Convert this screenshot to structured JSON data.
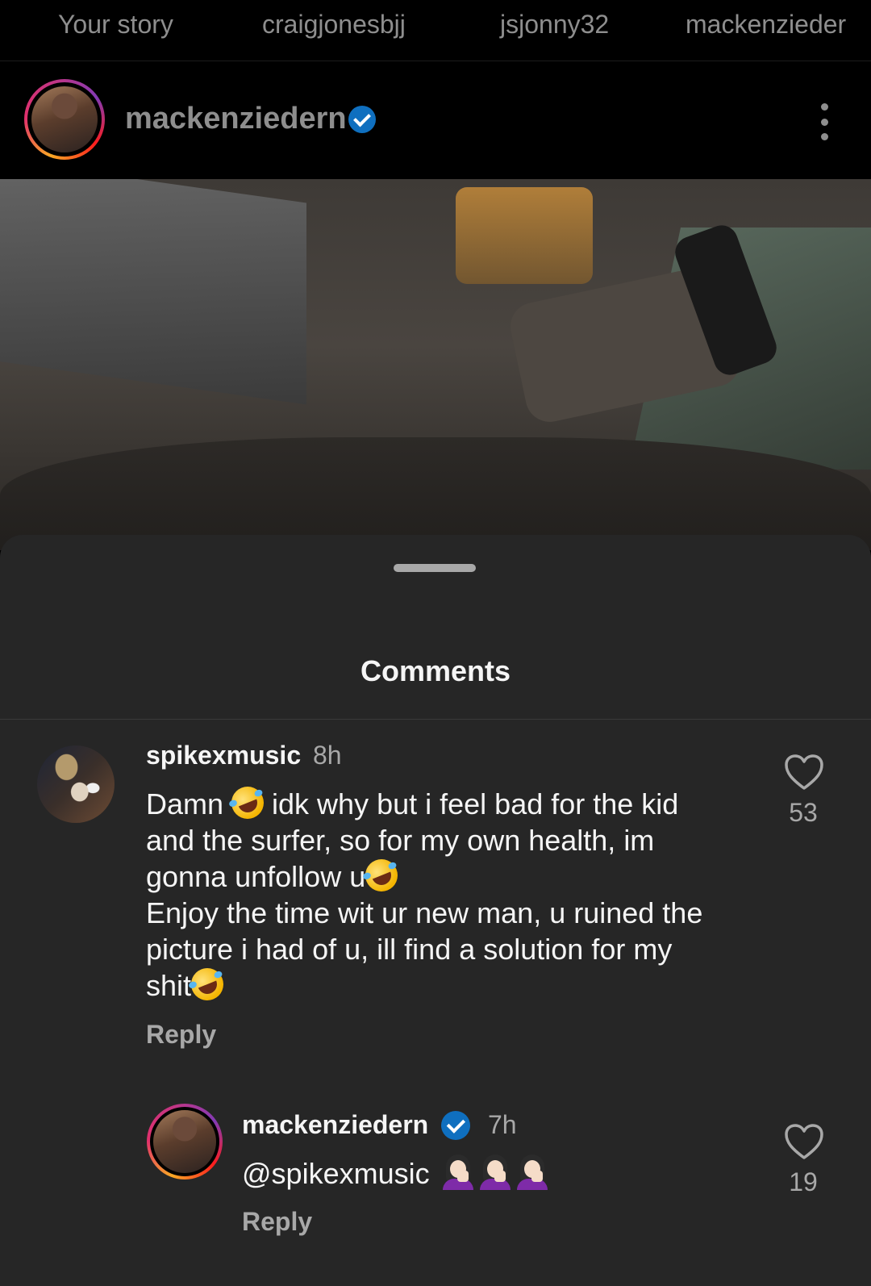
{
  "stories": {
    "tabs": [
      "Your story",
      "craigjonesbjj",
      "jsjonny32",
      "mackenzieder"
    ]
  },
  "post": {
    "username": "mackenziedern",
    "verified": true,
    "menu_icon": "more-vertical-icon"
  },
  "comments_sheet": {
    "title": "Comments",
    "comments": [
      {
        "username": "spikexmusic",
        "time": "8h",
        "text_parts": {
          "p1": "Damn ",
          "p2": " idk why but i feel bad for the kid\nand the surfer, so for my own health, im\ngonna unfollow u",
          "p3": "\nEnjoy the time wit ur new man, u ruined the\npicture i had of u, ill find a solution for my\nshit"
        },
        "emoji": "face-with-tears-of-joy",
        "likes": "53",
        "reply_label": "Reply"
      },
      {
        "username": "mackenziedern",
        "verified": true,
        "time": "7h",
        "text": "@spikexmusic ",
        "emoji": "woman-facepalming",
        "emoji_count": 3,
        "likes": "19",
        "reply_label": "Reply"
      }
    ]
  },
  "colors": {
    "background": "#000000",
    "sheet": "#262626",
    "primary_text": "#f5f5f5",
    "secondary_text": "#a8a8a8",
    "verified_badge": "#0f6fbf"
  }
}
